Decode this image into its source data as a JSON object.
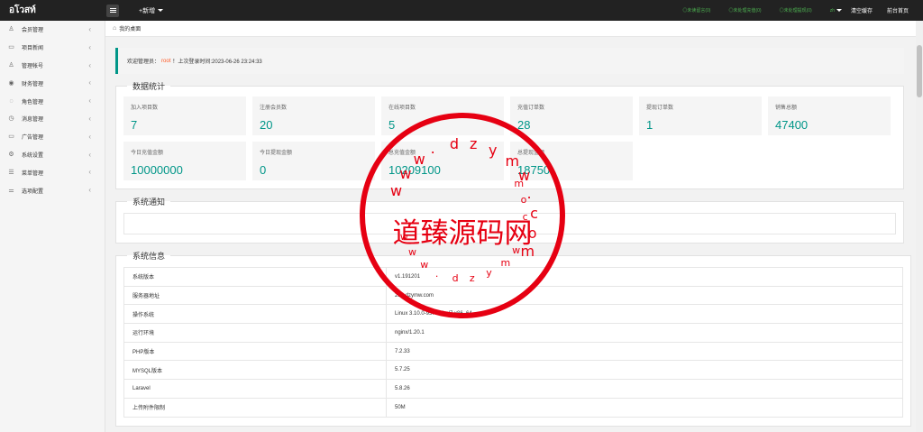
{
  "app": {
    "logo": "อโวสท์"
  },
  "topbar": {
    "add_label": "+新增",
    "links": [
      "◎未读留言(0)",
      "◎未处理充值(0)",
      "◎未处理提现(0)"
    ],
    "lang": "zh",
    "clear_cache": "清空缓存",
    "front_home": "前台首页"
  },
  "sidebar": {
    "items": [
      {
        "label": "会员管理",
        "icon": "user-icon"
      },
      {
        "label": "项目新闻",
        "icon": "news-icon"
      },
      {
        "label": "管理帐号",
        "icon": "admin-icon"
      },
      {
        "label": "财务管理",
        "icon": "finance-icon"
      },
      {
        "label": "角色管理",
        "icon": "role-icon"
      },
      {
        "label": "消息管理",
        "icon": "message-icon"
      },
      {
        "label": "广告管理",
        "icon": "ad-icon"
      },
      {
        "label": "系统设置",
        "icon": "settings-icon"
      },
      {
        "label": "菜单管理",
        "icon": "menu-icon"
      },
      {
        "label": "选项配置",
        "icon": "options-icon"
      }
    ]
  },
  "tab": {
    "label": "我的桌面"
  },
  "welcome": {
    "prefix": "欢迎管理员：",
    "user": "root",
    "suffix": "！上次登录时间:2023-06-26 23:24:33"
  },
  "stats": {
    "title": "数据统计",
    "items": [
      {
        "label": "加入项目数",
        "value": "7"
      },
      {
        "label": "注册会员数",
        "value": "20"
      },
      {
        "label": "在线项目数",
        "value": "5"
      },
      {
        "label": "充值订单数",
        "value": "28"
      },
      {
        "label": "提现订单数",
        "value": "1"
      },
      {
        "label": "销售总额",
        "value": "47400"
      },
      {
        "label": "今日充值金额",
        "value": "10000000"
      },
      {
        "label": "今日提现金额",
        "value": "0"
      },
      {
        "label": "总充值金额",
        "value": "10209100"
      },
      {
        "label": "总提现金额",
        "value": "18750"
      }
    ]
  },
  "notice": {
    "title": "系统通知"
  },
  "sysinfo": {
    "title": "系统信息",
    "rows": [
      {
        "key": "系统版本",
        "value": "v1.191201"
      },
      {
        "key": "服务器地址",
        "value": "218.dzymw.com"
      },
      {
        "key": "操作系统",
        "value": "Linux 3.10.0-957.1.3.el7.x86_64"
      },
      {
        "key": "运行环境",
        "value": "nginx/1.20.1"
      },
      {
        "key": "PHP版本",
        "value": "7.2.33"
      },
      {
        "key": "MYSQL版本",
        "value": "5.7.25"
      },
      {
        "key": "Laravel",
        "value": "5.8.26"
      },
      {
        "key": "上传附件限制",
        "value": "50M"
      }
    ]
  },
  "watermark": {
    "title": "道臻源码网",
    "url": "www.dzymw.com"
  }
}
